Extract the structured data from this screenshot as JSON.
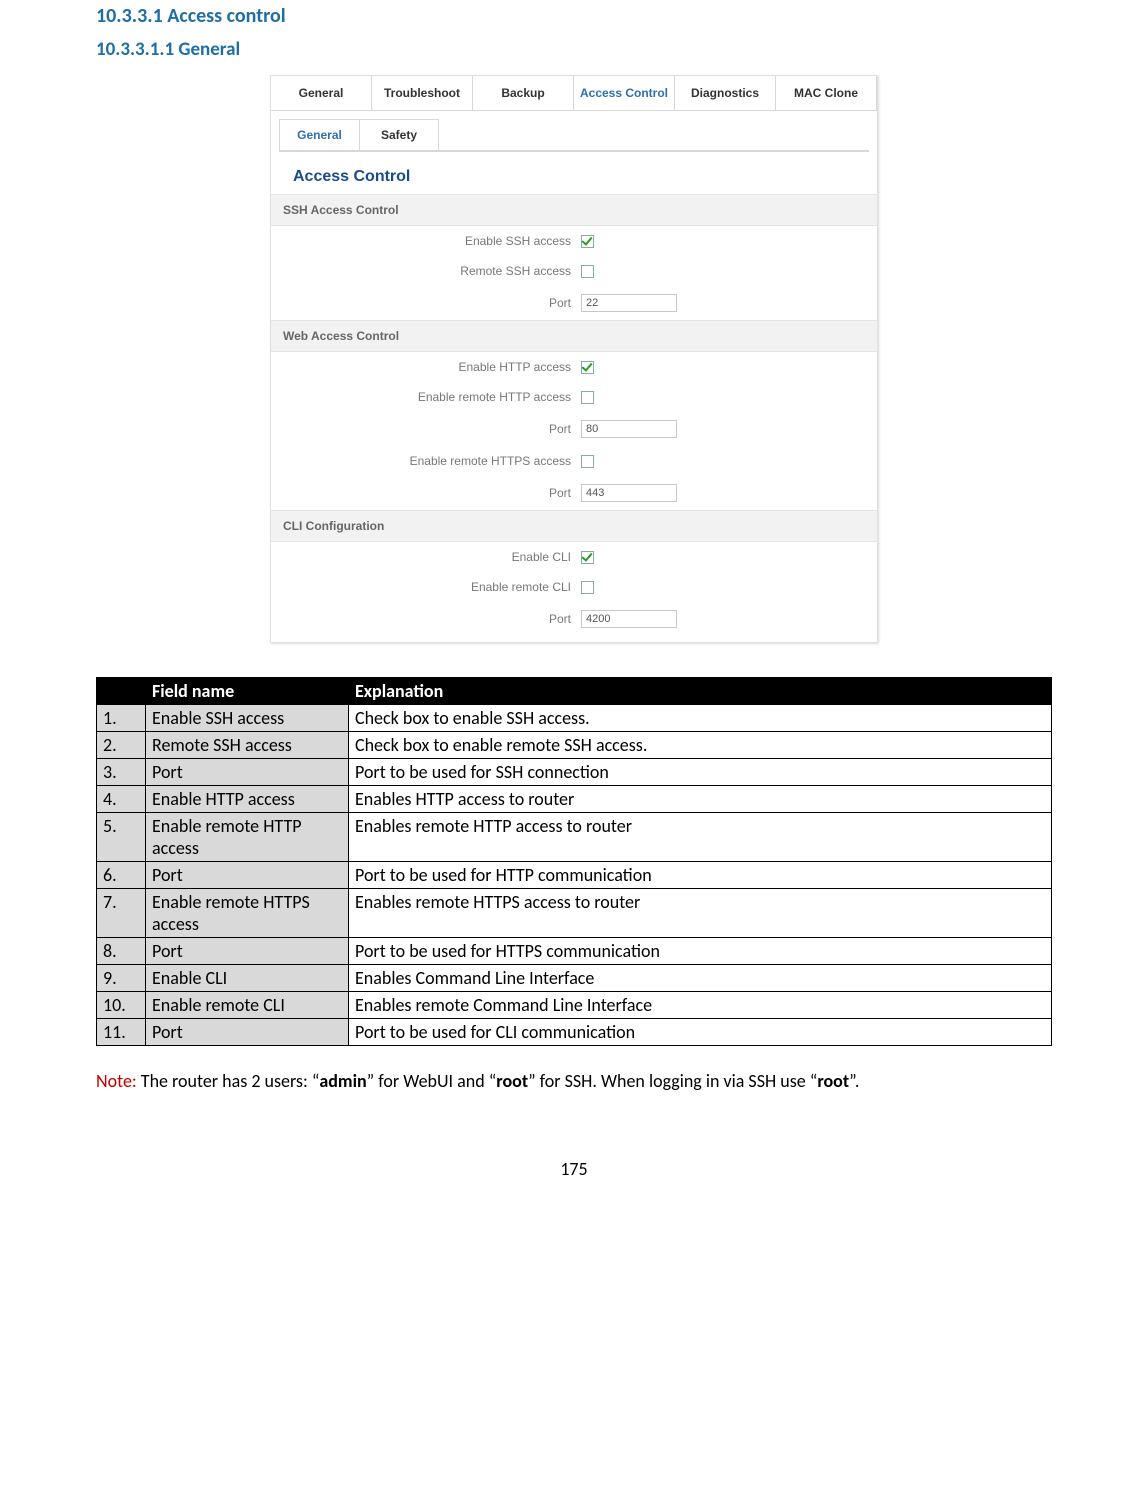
{
  "headings": {
    "h1": "10.3.3.1 Access control",
    "h2": "10.3.3.1.1 General"
  },
  "screenshot": {
    "topTabs": [
      "General",
      "Troubleshoot",
      "Backup",
      "Access Control",
      "Diagnostics",
      "MAC Clone"
    ],
    "topTabActiveIndex": 3,
    "subTabs": [
      "General",
      "Safety"
    ],
    "subTabActiveIndex": 0,
    "panelTitle": "Access Control",
    "sections": {
      "ssh": {
        "title": "SSH Access Control",
        "enableLabel": "Enable SSH access",
        "enableChecked": true,
        "remoteLabel": "Remote SSH access",
        "remoteChecked": false,
        "portLabel": "Port",
        "portValue": "22"
      },
      "web": {
        "title": "Web Access Control",
        "httpLabel": "Enable HTTP access",
        "httpChecked": true,
        "remoteHttpLabel": "Enable remote HTTP access",
        "remoteHttpChecked": false,
        "httpPortLabel": "Port",
        "httpPortValue": "80",
        "remoteHttpsLabel": "Enable remote HTTPS access",
        "remoteHttpsChecked": false,
        "httpsPortLabel": "Port",
        "httpsPortValue": "443"
      },
      "cli": {
        "title": "CLI Configuration",
        "enableLabel": "Enable CLI",
        "enableChecked": true,
        "remoteLabel": "Enable remote CLI",
        "remoteChecked": false,
        "portLabel": "Port",
        "portValue": "4200"
      }
    }
  },
  "table": {
    "headers": {
      "num": "",
      "field": "Field name",
      "explanation": "Explanation"
    },
    "rows": [
      {
        "num": "1.",
        "field": "Enable SSH access",
        "explanation": "Check box to enable SSH access."
      },
      {
        "num": "2.",
        "field": "Remote SSH access",
        "explanation": "Check box to enable remote SSH access."
      },
      {
        "num": "3.",
        "field": "Port",
        "explanation": "Port to be used for SSH connection"
      },
      {
        "num": "4.",
        "field": "Enable HTTP access",
        "explanation": "Enables HTTP access to router"
      },
      {
        "num": "5.",
        "field": "Enable remote HTTP access",
        "explanation": "Enables remote HTTP access to router"
      },
      {
        "num": "6.",
        "field": "Port",
        "explanation": "Port to be used for HTTP communication"
      },
      {
        "num": "7.",
        "field": "Enable remote HTTPS access",
        "explanation": "Enables remote HTTPS access to router"
      },
      {
        "num": "8.",
        "field": "Port",
        "explanation": "Port to be used for HTTPS communication"
      },
      {
        "num": "9.",
        "field": "Enable CLI",
        "explanation": "Enables Command Line Interface"
      },
      {
        "num": "10.",
        "field": "Enable remote CLI",
        "explanation": "Enables remote Command Line Interface"
      },
      {
        "num": "11.",
        "field": "Port",
        "explanation": "Port to be used for CLI communication"
      }
    ]
  },
  "note": {
    "label": "Note:",
    "pre": " The router has 2 users: “",
    "user1": "admin",
    "mid1": "” for WebUI and “",
    "user2": "root",
    "mid2": "” for SSH. When logging in via SSH use “",
    "user3": "root",
    "post": "”."
  },
  "pageNumber": "175"
}
